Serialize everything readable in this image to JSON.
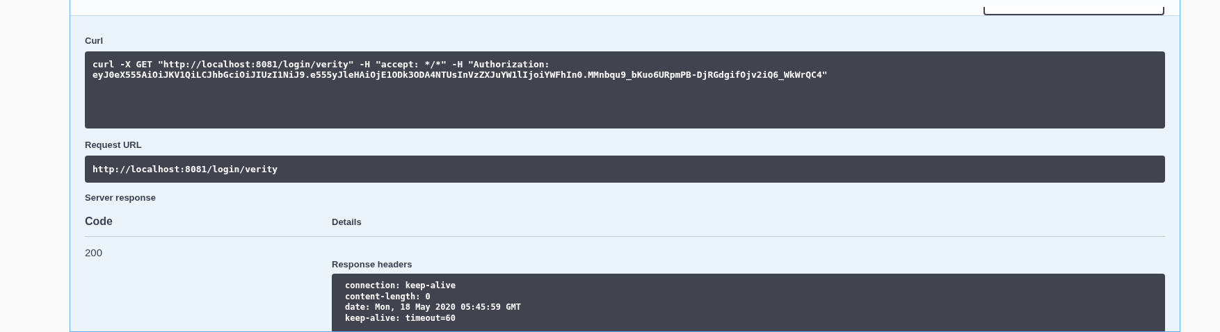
{
  "curl": {
    "label": "Curl",
    "command": "curl -X GET \"http://localhost:8081/login/verity\" -H \"accept: */*\" -H \"Authorization: eyJ0eX555AiOiJKV1QiLCJhbGciOiJIUzI1NiJ9.e555yJleHAiOjE1ODk3ODA4NTUsInVzZXJuYW1lIjoiYWFhIn0.MMnbqu9_bKuo6URpmPB-DjRGdgifOjv2iQ6_WkWrQC4\""
  },
  "request_url": {
    "label": "Request URL",
    "value": "http://localhost:8081/login/verity"
  },
  "server_response": {
    "label": "Server response",
    "columns": [
      "Code",
      "Details"
    ],
    "rows": [
      {
        "code": "200",
        "headers_label": "Response headers",
        "headers": [
          "connection: keep-alive",
          "content-length: 0",
          "date: Mon, 18 May 2020 05:45:59 GMT",
          "keep-alive: timeout=60"
        ]
      }
    ]
  }
}
